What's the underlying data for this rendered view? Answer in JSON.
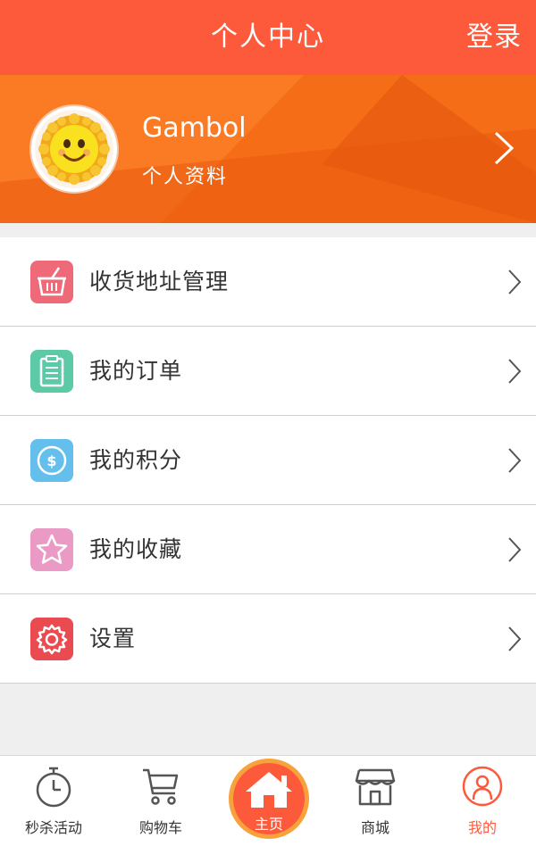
{
  "header": {
    "title": "个人中心",
    "login_label": "登录"
  },
  "profile": {
    "name": "Gambol",
    "subtitle": "个人资料"
  },
  "menu": [
    {
      "label": "收货地址管理",
      "icon": "basket-icon",
      "color": "#ee6a79"
    },
    {
      "label": "我的订单",
      "icon": "clipboard-icon",
      "color": "#5ccaa6"
    },
    {
      "label": "我的积分",
      "icon": "coin-icon",
      "color": "#65bfec"
    },
    {
      "label": "我的收藏",
      "icon": "star-icon",
      "color": "#eb9ac6"
    },
    {
      "label": "设置",
      "icon": "gear-icon",
      "color": "#ea4b50"
    }
  ],
  "tabs": [
    {
      "label": "秒杀活动",
      "icon": "stopwatch-icon"
    },
    {
      "label": "购物车",
      "icon": "cart-icon"
    },
    {
      "label": "主页",
      "icon": "home-icon"
    },
    {
      "label": "商城",
      "icon": "store-icon"
    },
    {
      "label": "我的",
      "icon": "user-icon",
      "active": true
    }
  ],
  "colors": {
    "brand": "#fd5a3c",
    "profile_bg": "#fa6f22",
    "active_tab": "#fd5a3c"
  }
}
